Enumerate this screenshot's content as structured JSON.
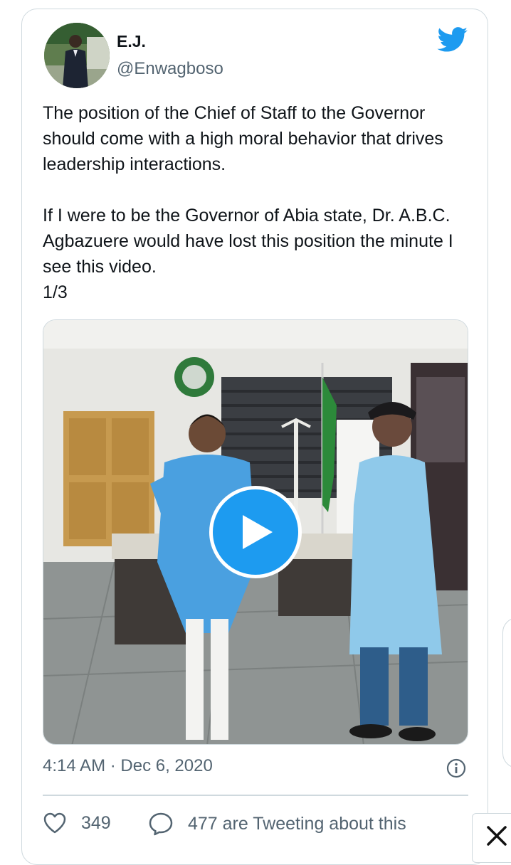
{
  "tweet": {
    "author_name": "E.J.",
    "author_handle": "@Enwagboso",
    "text": "The position of the Chief of Staff to the Governor should come with a high moral behavior that drives leadership interactions.\n\nIf I were to be the Governor of Abia state, Dr. A.B.C. Agbazuere would have lost this position the minute I see this video.\n1/3",
    "timestamp": "4:14 AM · Dec 6, 2020",
    "like_count": "349",
    "tweeting_text": "477 are Tweeting about this"
  },
  "icons": {
    "brand": "twitter-bird-icon",
    "media": "play-icon",
    "info": "info-icon",
    "like": "heart-icon",
    "reply": "speech-bubble-icon",
    "close": "close-icon"
  },
  "colors": {
    "brand_blue": "#1d9bf0",
    "text_primary": "#0f1419",
    "text_secondary": "#536471",
    "border": "#cfd9de"
  }
}
